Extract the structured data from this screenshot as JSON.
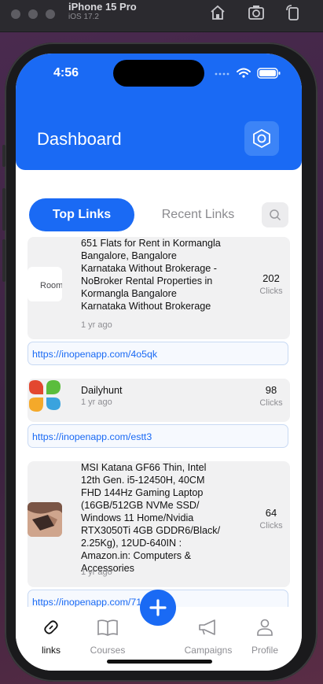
{
  "simulator": {
    "device": "iPhone 15 Pro",
    "os": "iOS 17.2"
  },
  "status": {
    "time": "4:56"
  },
  "header": {
    "title": "Dashboard"
  },
  "tabs": {
    "top": "Top Links",
    "recent": "Recent Links"
  },
  "links": [
    {
      "title": "651   Flats for Rent in Kormangla Bangalore, Bangalore Karnataka Without Brokerage - NoBroker Rental Properties in Kormangla Bangalore Karnataka Without Brokerage",
      "thumb_text": "Room",
      "ago": "1 yr ago",
      "clicks": "202",
      "clicks_label": "Clicks",
      "url": "https://inopenapp.com/4o5qk"
    },
    {
      "title": "Dailyhunt",
      "ago": "1 yr ago",
      "clicks": "98",
      "clicks_label": "Clicks",
      "url": "https://inopenapp.com/estt3"
    },
    {
      "title": "MSI Katana GF66 Thin, Intel 12th Gen. i5-12450H, 40CM FHD 144Hz Gaming Laptop (16GB/512GB NVMe SSD/ Windows 11 Home/Nvidia RTX3050Ti 4GB GDDR6/Black/ 2.25Kg), 12UD-640IN : Amazon.in: Computers & Accessories",
      "ago": "1 yr ago",
      "clicks": "64",
      "clicks_label": "Clicks",
      "url": "https://inopenapp.com/71"
    }
  ],
  "nav": {
    "links": "links",
    "courses": "Courses",
    "campaigns": "Campaigns",
    "profile": "Profile"
  },
  "colors": {
    "primary": "#1a6af4",
    "card_bg": "#f1f1f2"
  }
}
